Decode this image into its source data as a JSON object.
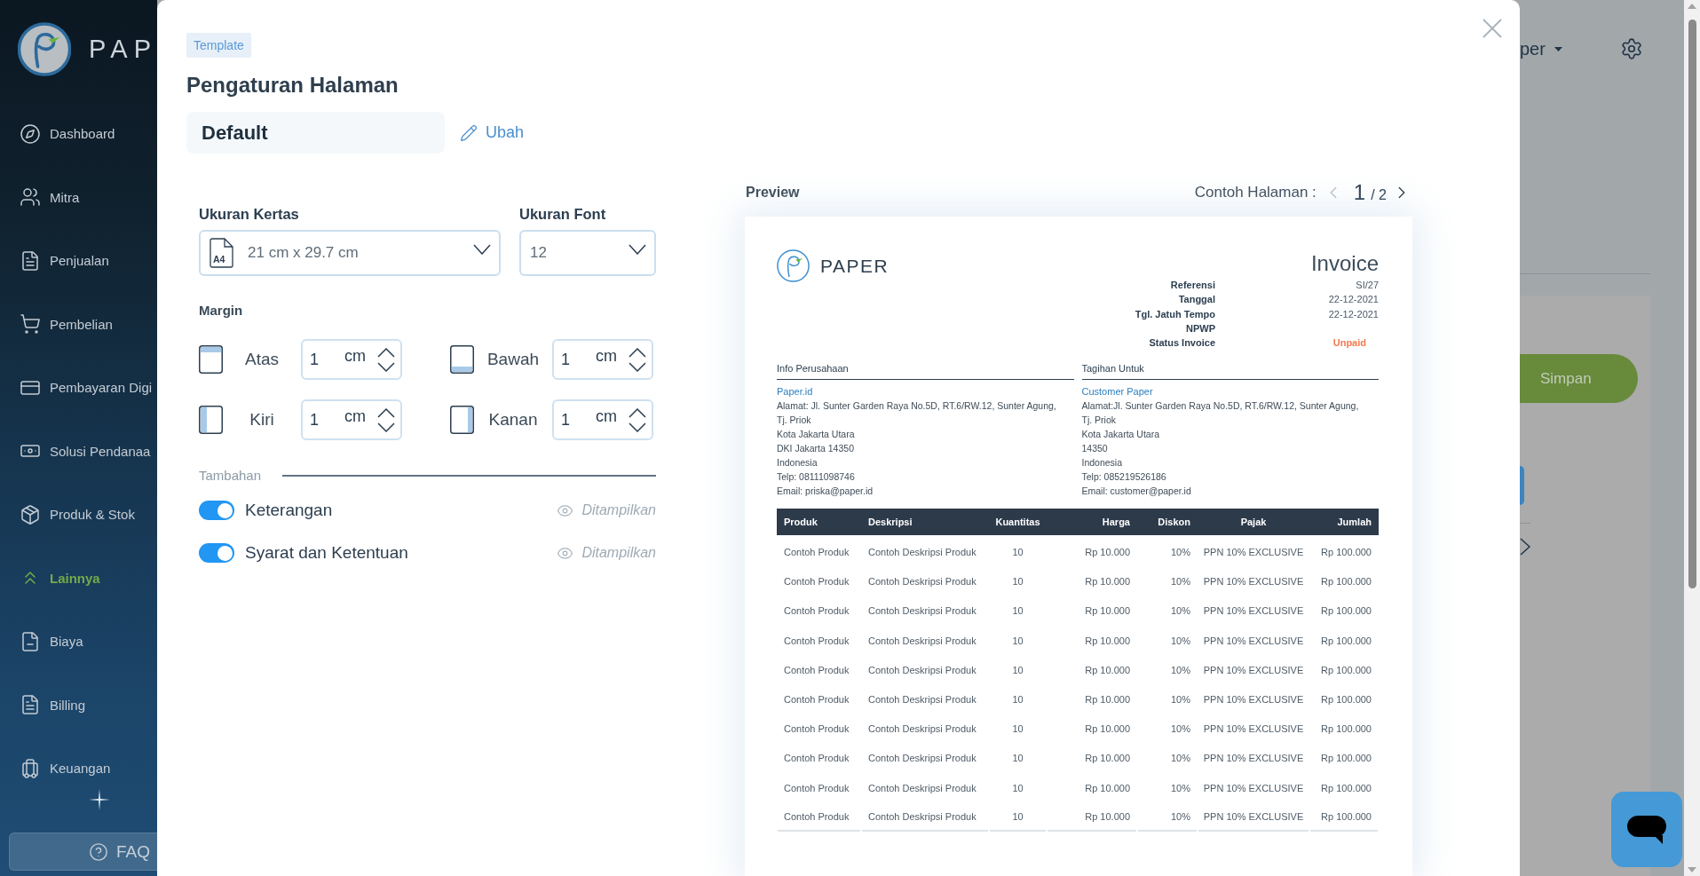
{
  "sidebar": {
    "logo_text": "PAP",
    "items": [
      {
        "label": "Dashboard",
        "selected": false
      },
      {
        "label": "Mitra",
        "selected": false
      },
      {
        "label": "Penjualan",
        "selected": false
      },
      {
        "label": "Pembelian",
        "selected": false
      },
      {
        "label": "Pembayaran Digi",
        "selected": false
      },
      {
        "label": "Solusi Pendanaa",
        "selected": false
      },
      {
        "label": "Produk & Stok",
        "selected": false
      },
      {
        "label": "Lainnya",
        "selected": true
      },
      {
        "label": "Biaya",
        "selected": false
      },
      {
        "label": "Billing",
        "selected": false
      },
      {
        "label": "Keuangan",
        "selected": false
      }
    ],
    "faq_button": "FAQ"
  },
  "header": {
    "user_menu": "per"
  },
  "page": {
    "save_button": "Simpan"
  },
  "modal": {
    "tag": "Template",
    "title": "Pengaturan Halaman",
    "template_name": "Default",
    "edit_link": "Ubah",
    "paper_size": {
      "label": "Ukuran Kertas",
      "format": "A4",
      "value": "21 cm x 29.7 cm"
    },
    "font_size": {
      "label": "Ukuran Font",
      "value": "12"
    },
    "margin": {
      "label": "Margin",
      "fields": [
        {
          "label": "Atas",
          "value": "1",
          "unit": "cm"
        },
        {
          "label": "Bawah",
          "value": "1",
          "unit": "cm"
        },
        {
          "label": "Kiri",
          "value": "1",
          "unit": "cm"
        },
        {
          "label": "Kanan",
          "value": "1",
          "unit": "cm"
        }
      ]
    },
    "extras": {
      "label": "Tambahan",
      "items": [
        {
          "label": "Keterangan",
          "on": true,
          "status": "Ditampilkan"
        },
        {
          "label": "Syarat dan Ketentuan",
          "on": true,
          "status": "Ditampilkan"
        }
      ]
    },
    "preview": {
      "label": "Preview",
      "pager": {
        "label": "Contoh Halaman :",
        "current": "1",
        "total": "/ 2",
        "prev": {
          "disabled": true
        },
        "next": {
          "disabled": false
        }
      },
      "document": {
        "brand": "PAPER",
        "title": "Invoice",
        "meta": [
          {
            "label": "Referensi",
            "value": "SI/27",
            "kind": "text"
          },
          {
            "label": "Tanggal",
            "value": "22-12-2021",
            "kind": "text"
          },
          {
            "label": "Tgl. Jatuh Tempo",
            "value": "22-12-2021",
            "kind": "text"
          },
          {
            "label": "NPWP",
            "kind": "text"
          },
          {
            "label": "Status Invoice",
            "value": "Unpaid",
            "kind": "status"
          }
        ],
        "parties": [
          {
            "heading": "Info Perusahaan",
            "name": "Paper.id",
            "lines": [
              "Alamat: Jl. Sunter Garden Raya No.5D, RT.6/RW.12, Sunter Agung,",
              "Tj. Priok",
              "Kota Jakarta Utara",
              "DKI Jakarta 14350",
              "Indonesia",
              "Telp: 08111098746",
              "Email: priska@paper.id"
            ]
          },
          {
            "heading": "Tagihan Untuk",
            "name": "Customer Paper",
            "lines": [
              "Alamat:Jl. Sunter Garden Raya No.5D, RT.6/RW.12, Sunter Agung,",
              "Tj. Priok",
              "Kota Jakarta Utara",
              "14350",
              "Indonesia",
              "Telp: 085219526186",
              "Email: customer@paper.id"
            ]
          }
        ],
        "table": {
          "columns": [
            "Produk",
            "Deskripsi",
            "Kuantitas",
            "Harga",
            "Diskon",
            "Pajak",
            "Jumlah"
          ],
          "rows": [
            [
              "Contoh Produk",
              "Contoh Deskripsi Produk",
              "10",
              "Rp 10.000",
              "10%",
              "PPN 10% EXCLUSIVE",
              "Rp 100.000"
            ],
            [
              "Contoh Produk",
              "Contoh Deskripsi Produk",
              "10",
              "Rp 10.000",
              "10%",
              "PPN 10% EXCLUSIVE",
              "Rp 100.000"
            ],
            [
              "Contoh Produk",
              "Contoh Deskripsi Produk",
              "10",
              "Rp 10.000",
              "10%",
              "PPN 10% EXCLUSIVE",
              "Rp 100.000"
            ],
            [
              "Contoh Produk",
              "Contoh Deskripsi Produk",
              "10",
              "Rp 10.000",
              "10%",
              "PPN 10% EXCLUSIVE",
              "Rp 100.000"
            ],
            [
              "Contoh Produk",
              "Contoh Deskripsi Produk",
              "10",
              "Rp 10.000",
              "10%",
              "PPN 10% EXCLUSIVE",
              "Rp 100.000"
            ],
            [
              "Contoh Produk",
              "Contoh Deskripsi Produk",
              "10",
              "Rp 10.000",
              "10%",
              "PPN 10% EXCLUSIVE",
              "Rp 100.000"
            ],
            [
              "Contoh Produk",
              "Contoh Deskripsi Produk",
              "10",
              "Rp 10.000",
              "10%",
              "PPN 10% EXCLUSIVE",
              "Rp 100.000"
            ],
            [
              "Contoh Produk",
              "Contoh Deskripsi Produk",
              "10",
              "Rp 10.000",
              "10%",
              "PPN 10% EXCLUSIVE",
              "Rp 100.000"
            ],
            [
              "Contoh Produk",
              "Contoh Deskripsi Produk",
              "10",
              "Rp 10.000",
              "10%",
              "PPN 10% EXCLUSIVE",
              "Rp 100.000"
            ],
            [
              "Contoh Produk",
              "Contoh Deskripsi Produk",
              "10",
              "Rp 10.000",
              "10%",
              "PPN 10% EXCLUSIVE",
              "Rp 100.000"
            ]
          ]
        }
      }
    }
  }
}
